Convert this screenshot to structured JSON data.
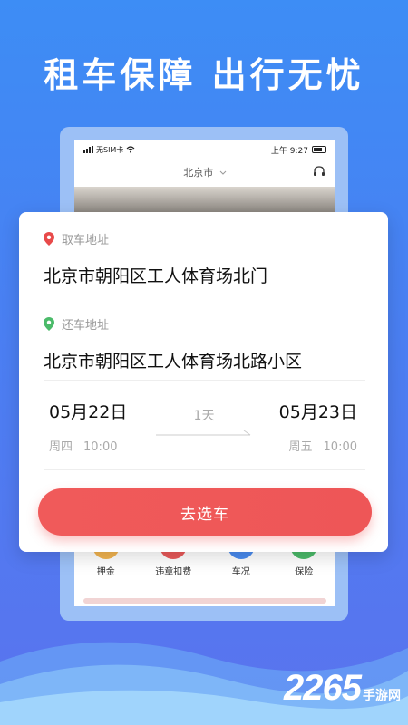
{
  "headline": "租车保障 出行无忧",
  "phone": {
    "carrier": "无SIM卡",
    "time": "上午 9:27",
    "city": "北京市",
    "services": [
      {
        "label": "押金",
        "color": "#f2b450"
      },
      {
        "label": "违章扣费",
        "color": "#ea5a5a"
      },
      {
        "label": "车况",
        "color": "#4a8cf0"
      },
      {
        "label": "保险",
        "color": "#4bbb6a"
      }
    ]
  },
  "pickup": {
    "label": "取车地址",
    "address": "北京市朝阳区工人体育场北门",
    "pin_color": "#e84a4a"
  },
  "return": {
    "label": "还车地址",
    "address": "北京市朝阳区工人体育场北路小区",
    "pin_color": "#4bbb6a"
  },
  "dates": {
    "start_date": "05月22日",
    "start_weekday": "周四",
    "start_time": "10:00",
    "duration": "1天",
    "end_date": "05月23日",
    "end_weekday": "周五",
    "end_time": "10:00"
  },
  "action": {
    "button_label": "去选车"
  },
  "watermark": {
    "number": "2265",
    "suffix": "手游网"
  }
}
